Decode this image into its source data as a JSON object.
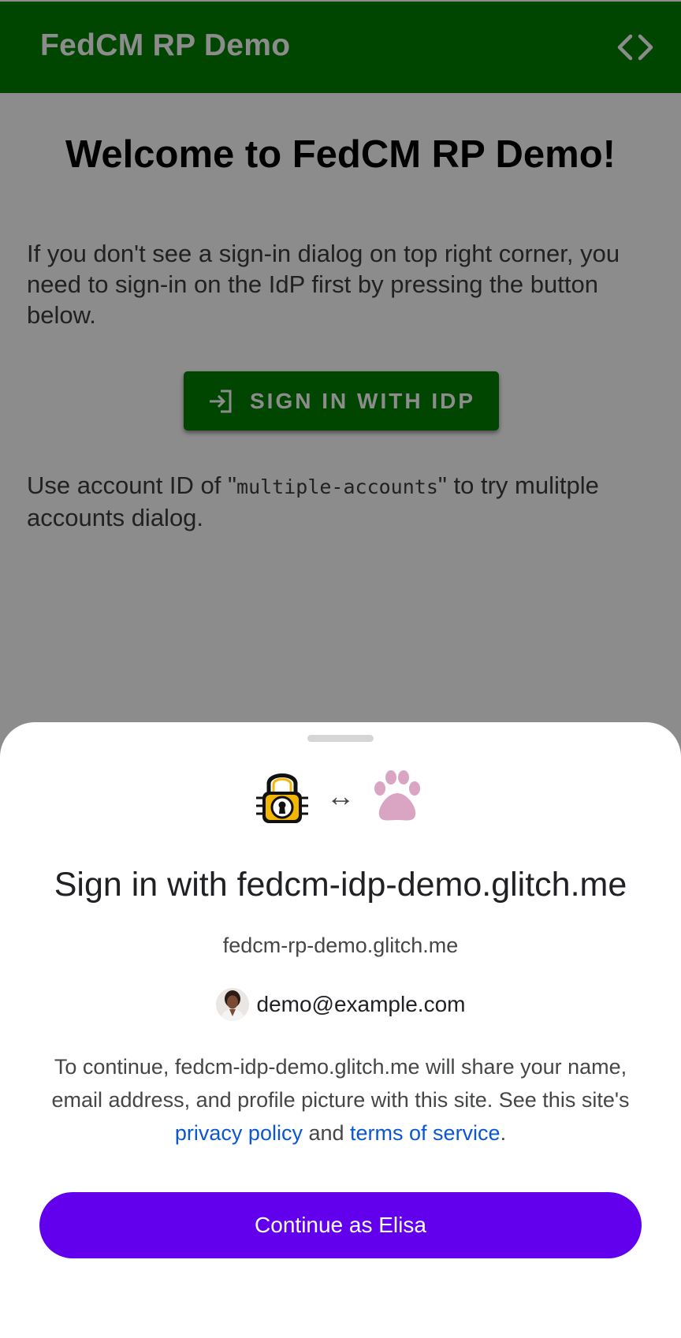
{
  "app_bar": {
    "title": "FedCM RP Demo",
    "code_icon": "code-brackets-icon",
    "background_color": "#008000"
  },
  "main": {
    "welcome_heading": "Welcome to FedCM RP Demo!",
    "intro_text": "If you don't see a sign-in dialog on top right corner, you need to sign-in on the IdP first by pressing the button below.",
    "sign_in_button": {
      "icon": "login-icon",
      "label": "SIGN IN WITH IDP"
    },
    "usage_prefix": "Use account ID of \"",
    "usage_code": "multiple-accounts",
    "usage_suffix": "\" to try mulitple accounts dialog."
  },
  "sheet": {
    "rp_logo": "padlock-logo-icon",
    "link_arrow": "↔",
    "idp_logo": "paw-logo-icon",
    "title": "Sign in with fedcm-idp-demo.glitch.me",
    "rp_domain": "fedcm-rp-demo.glitch.me",
    "account": {
      "avatar": "profile-avatar",
      "email": "demo@example.com"
    },
    "disclosure_prefix": "To continue, fedcm-idp-demo.glitch.me will share your name, email address, and profile picture with this site. See this site's ",
    "privacy_policy_link": "privacy policy",
    "disclosure_and": " and ",
    "terms_link": "terms of service",
    "disclosure_end": ".",
    "continue_button": "Continue as Elisa",
    "accent_color": "#6200ee",
    "link_color": "#0b57d0"
  }
}
